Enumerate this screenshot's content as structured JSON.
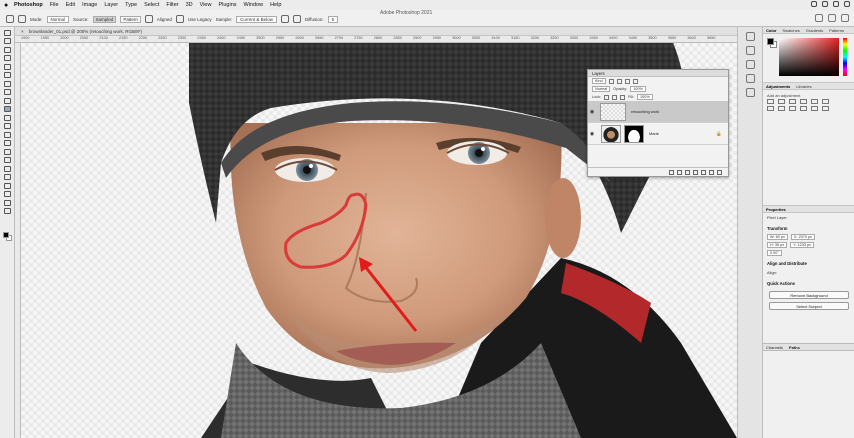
{
  "menubar": {
    "app_name": "Photoshop",
    "items": [
      "File",
      "Edit",
      "Image",
      "Layer",
      "Type",
      "Select",
      "Filter",
      "3D",
      "View",
      "Plugins",
      "Window",
      "Help"
    ]
  },
  "window_title": "Adobe Photoshop 2021",
  "options_bar": {
    "mode_label": "Mode:",
    "mode_value": "Normal",
    "source_label": "Source:",
    "source_options": [
      "Sampled",
      "Pattern"
    ],
    "aligned_label": "Aligned",
    "use_legacy_label": "Use Legacy",
    "sample_label": "Sample:",
    "sample_value": "Current & Below",
    "diffusion_label": "Diffusion:",
    "diffusion_value": "5"
  },
  "document": {
    "tab_title": "brownlander_01.psd @ 200% (retouching work, RGB/8*)"
  },
  "ruler": {
    "ticks": [
      "1900",
      "1950",
      "2000",
      "2050",
      "2100",
      "2150",
      "2200",
      "2250",
      "2300",
      "2350",
      "2400",
      "2450",
      "2500",
      "2550",
      "2600",
      "2650",
      "2700",
      "2750",
      "2800",
      "2850",
      "2900",
      "2950",
      "3000",
      "3050",
      "3100",
      "3150",
      "3200",
      "3250",
      "3300",
      "3350",
      "3400",
      "3450",
      "3500",
      "3550",
      "3600",
      "3650"
    ]
  },
  "color_panel": {
    "tabs": [
      "Color",
      "Swatches",
      "Gradients",
      "Patterns"
    ],
    "hue_color": "#e52222"
  },
  "adjustments_panel": {
    "tabs": [
      "Adjustments",
      "Libraries"
    ],
    "add_label": "Add an adjustment"
  },
  "layers_panel": {
    "title": "Layers",
    "kind_value": "Kind",
    "blend_mode": "Normal",
    "opacity_label": "Opacity:",
    "opacity_value": "100%",
    "lock_label": "Lock:",
    "fill_label": "Fill:",
    "fill_value": "100%",
    "layers": [
      {
        "name": "retouching work",
        "selected": true
      },
      {
        "name": "Marie",
        "selected": false
      }
    ]
  },
  "properties_panel": {
    "title": "Properties",
    "subtitle": "Pixel Layer",
    "transform_label": "Transform",
    "w_value": "W: 60 px",
    "x_value": "X: 2370 px",
    "h_value": "H: 35 px",
    "y_value": "Y: 1233 px",
    "angle_value": "0.00°",
    "align_label": "Align and Distribute",
    "align_sub": "Align:",
    "quick_actions_label": "Quick Actions",
    "remove_bg_button": "Remove Background",
    "select_subject_button": "Select Subject"
  },
  "bottom_tabs": [
    "Channels",
    "Paths"
  ],
  "annotation": {
    "outline_color": "#d93a3a",
    "arrow_color": "#e21b1b"
  }
}
